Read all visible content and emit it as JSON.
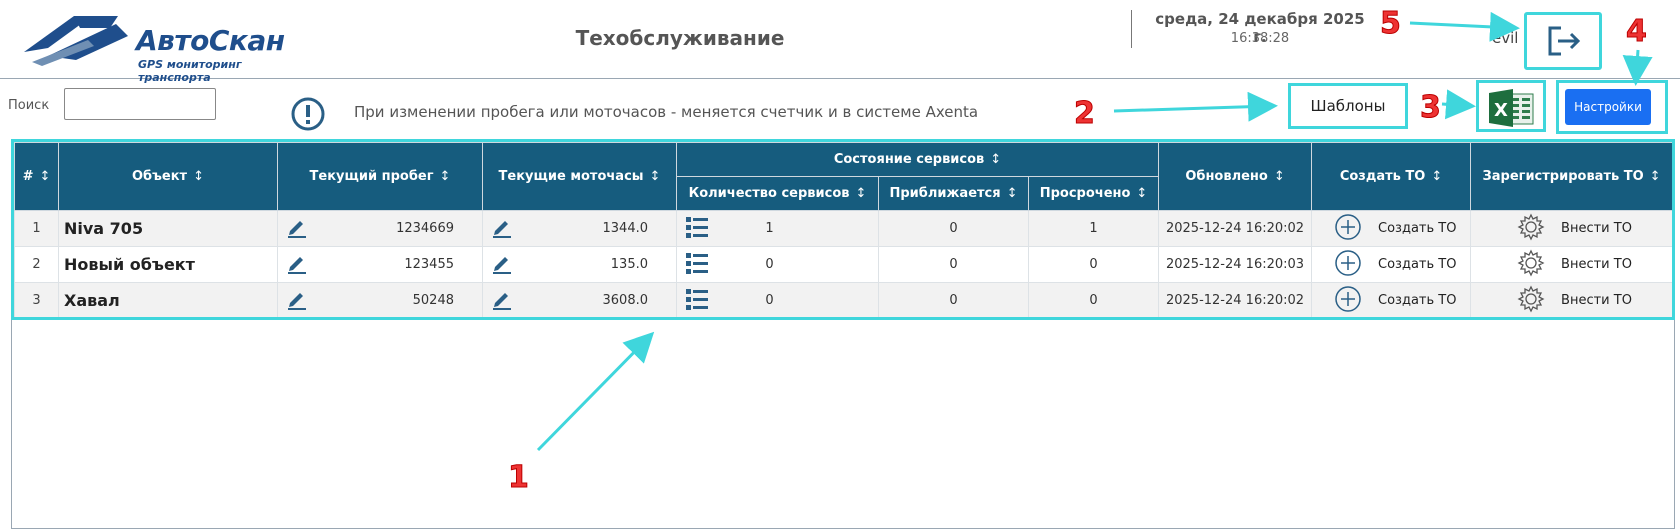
{
  "header": {
    "logo_text": "АвтоСкан",
    "logo_subtitle": "GPS мониторинг транспорта",
    "page_title": "Техобслуживание",
    "date": "среда, 24 декабря 2025 г.",
    "time": "16:38:28",
    "user": "evil",
    "logout_icon": "logout-icon"
  },
  "toolbar": {
    "search_label": "Поиск",
    "search_value": "",
    "info_text": "При изменении пробега или моточасов - меняется счетчик и в системе Axenta",
    "templates_label": "Шаблоны",
    "excel_icon": "excel-icon",
    "settings_label": "Настройки"
  },
  "table": {
    "headers": {
      "num": "#",
      "object": "Объект",
      "mileage": "Текущий пробег",
      "engine_hours": "Текущие моточасы",
      "services_state": "Состояние сервисов",
      "services_count": "Количество сервисов",
      "approaching": "Приближается",
      "overdue": "Просрочено",
      "updated": "Обновлено",
      "create_to": "Создать ТО",
      "register_to": "Зарегистрировать ТО"
    },
    "sort_glyph": "↕",
    "rows": [
      {
        "num": "1",
        "object": "Niva 705",
        "mileage": "1234669",
        "engine_hours": "1344.0",
        "services_count": "1",
        "approaching": "0",
        "overdue": "1",
        "updated": "2025-12-24 16:20:02",
        "create_label": "Создать ТО",
        "register_label": "Внести ТО"
      },
      {
        "num": "2",
        "object": "Новый объект",
        "mileage": "123455",
        "engine_hours": "135.0",
        "services_count": "0",
        "approaching": "0",
        "overdue": "0",
        "updated": "2025-12-24 16:20:03",
        "create_label": "Создать ТО",
        "register_label": "Внести ТО"
      },
      {
        "num": "3",
        "object": "Хавал",
        "mileage": "50248",
        "engine_hours": "3608.0",
        "services_count": "0",
        "approaching": "0",
        "overdue": "0",
        "updated": "2025-12-24 16:20:02",
        "create_label": "Создать ТО",
        "register_label": "Внести ТО"
      }
    ]
  },
  "annotations": [
    "1",
    "2",
    "3",
    "4",
    "5"
  ],
  "colors": {
    "header_bg": "#165c7e",
    "highlight": "#3fd6dc",
    "annotation": "#e33333",
    "primary_button": "#1a6ff2"
  }
}
